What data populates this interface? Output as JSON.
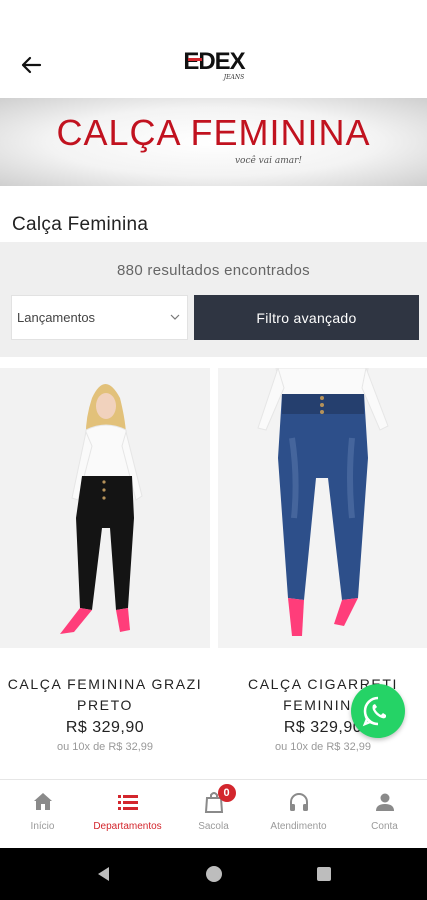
{
  "header": {
    "back_label": "Voltar",
    "logo_text": "EDEX",
    "logo_sub": "JEANS"
  },
  "banner": {
    "title": "CALÇA FEMININA",
    "subtitle": "você vai amar!"
  },
  "page": {
    "title": "Calça Feminina"
  },
  "filters": {
    "results_text": "880 resultados encontrados",
    "sort_selected": "Lançamentos",
    "advanced_filter_label": "Filtro avançado"
  },
  "products": [
    {
      "name": "CALÇA FEMININA GRAZI PRETO",
      "price": "R$ 329,90",
      "installments": "ou 10x de R$ 32,99",
      "jeans_color": "#141414"
    },
    {
      "name": "CALÇA CIGARRETI FEMININA",
      "price": "R$ 329,90",
      "installments": "ou 10x de R$ 32,99",
      "jeans_color": "#2d4f8a"
    }
  ],
  "bottom_nav": {
    "items": [
      {
        "label": "Início",
        "icon": "home-icon"
      },
      {
        "label": "Departamentos",
        "icon": "list-icon"
      },
      {
        "label": "Sacola",
        "icon": "bag-icon",
        "badge": "0"
      },
      {
        "label": "Atendimento",
        "icon": "headset-icon"
      },
      {
        "label": "Conta",
        "icon": "user-icon"
      }
    ],
    "active_index": 1
  },
  "colors": {
    "accent": "#d3262d",
    "brand_red": "#c1121f",
    "button_dark": "#2f3542",
    "whatsapp": "#25d366"
  }
}
